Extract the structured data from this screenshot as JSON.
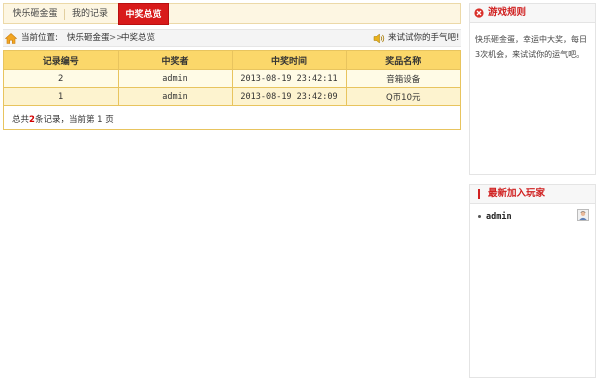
{
  "tabs": [
    {
      "label": "快乐砸金蛋",
      "active": false
    },
    {
      "label": "我的记录",
      "active": false
    },
    {
      "label": "中奖总览",
      "active": true
    }
  ],
  "breadcrumb": {
    "prefix": "当前位置:",
    "link": "快乐砸金蛋",
    "separator": ">>",
    "current": "中奖总览"
  },
  "marquee": "来试试你的手气吧!",
  "table": {
    "headers": [
      "记录编号",
      "中奖者",
      "中奖时间",
      "奖品名称"
    ],
    "rows": [
      [
        "2",
        "admin",
        "2013-08-19 23:42:11",
        "音箱设备"
      ],
      [
        "1",
        "admin",
        "2013-08-19 23:42:09",
        "Q币10元"
      ]
    ]
  },
  "pager": {
    "before": "总共",
    "count": "2",
    "middle": "条记录，当前第",
    "page": "1",
    "after": "页"
  },
  "rules_panel": {
    "title": "游戏规则",
    "text": "快乐砸金蛋，幸运中大奖，每日3次机会，来试试你的运气吧。"
  },
  "players_panel": {
    "title": "最新加入玩家",
    "players": [
      "admin"
    ]
  },
  "colors": {
    "accent_red": "#d81a1a",
    "header_yellow": "#fbd76a",
    "border_gold": "#e8c45e"
  }
}
